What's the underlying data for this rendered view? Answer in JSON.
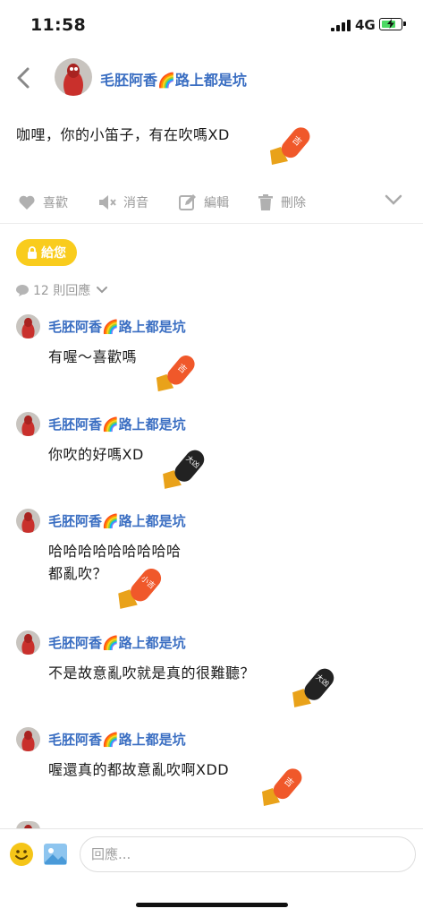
{
  "status_bar": {
    "time": "11:58",
    "network": "4G"
  },
  "post": {
    "author": "毛胚阿香🌈路上都是坑",
    "body": "咖哩，你的小笛子，有在吹嗎XD"
  },
  "actions": {
    "like": "喜歡",
    "mute": "消音",
    "edit": "編輯",
    "delete": "刪除"
  },
  "give_label": "給您",
  "reply_count": "12 則回應",
  "comments": [
    {
      "author": "毛胚阿香🌈路上都是坑",
      "lines": [
        "有喔～喜歡嗎"
      ]
    },
    {
      "author": "毛胚阿香🌈路上都是坑",
      "lines": [
        "你吹的好嗎XD"
      ]
    },
    {
      "author": "毛胚阿香🌈路上都是坑",
      "lines": [
        "哈哈哈哈哈哈哈哈哈",
        "都亂吹？"
      ]
    },
    {
      "author": "毛胚阿香🌈路上都是坑",
      "lines": [
        "不是故意亂吹就是真的很難聽？"
      ]
    },
    {
      "author": "毛胚阿香🌈路上都是坑",
      "lines": [
        "喔還真的都故意亂吹啊XDD"
      ]
    }
  ],
  "reply_box": {
    "placeholder": "回應..."
  },
  "colors": {
    "author_blue": "#3a6ec2",
    "give_yellow": "#f9cc1d",
    "sticker_orange": "#f0582a",
    "sticker_black": "#222222"
  },
  "sticker_text": {
    "orange": "吉",
    "black": "大凶",
    "orange_small": "小吉"
  }
}
